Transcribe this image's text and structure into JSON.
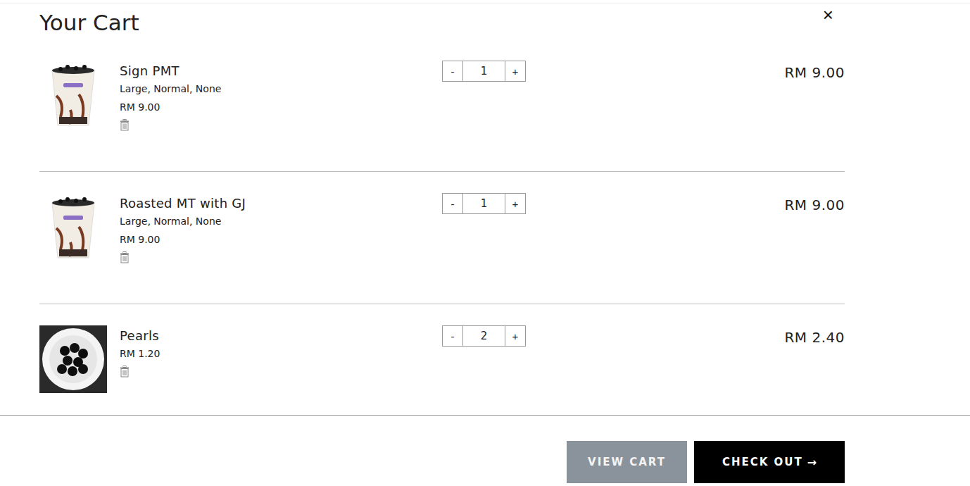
{
  "window": {
    "title": "Your Cart",
    "close": "×"
  },
  "items": [
    {
      "name": "Sign PMT",
      "kind": "drink",
      "options": "Large, Normal, None",
      "unit_price": "RM 9.00",
      "quantity": "1",
      "total": "RM 9.00",
      "decrement": "-",
      "increment": "+"
    },
    {
      "name": "Roasted MT with GJ",
      "kind": "drink",
      "options": "Large, Normal, None",
      "unit_price": "RM 9.00",
      "quantity": "1",
      "total": "RM 9.00",
      "decrement": "-",
      "increment": "+"
    },
    {
      "name": "Pearls",
      "kind": "topping",
      "options": "",
      "unit_price": "RM 1.20",
      "quantity": "2",
      "total": "RM 2.40",
      "decrement": "-",
      "increment": "+"
    }
  ],
  "buttons": {
    "view_cart": "VIEW CART",
    "check_out": "CHECK OUT",
    "check_out_arrow": "→"
  }
}
